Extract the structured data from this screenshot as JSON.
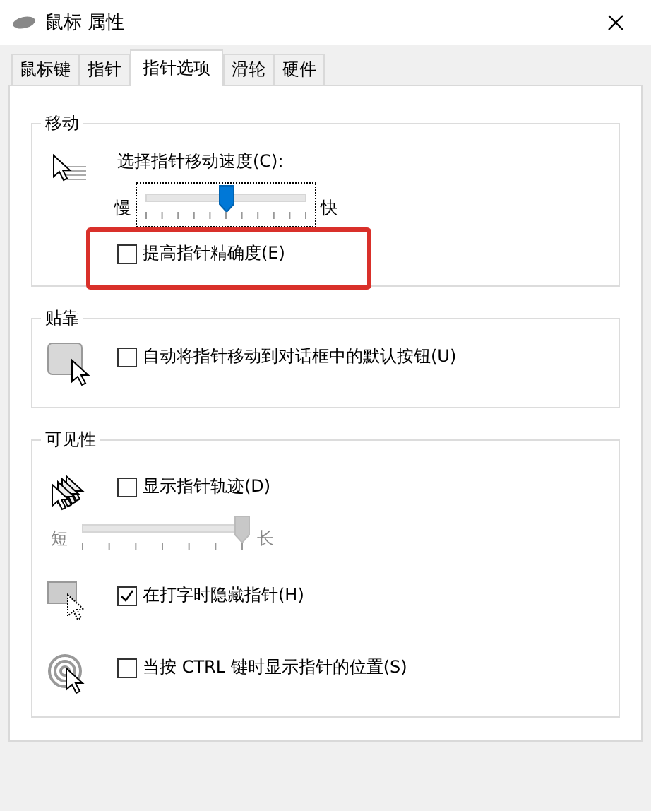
{
  "window": {
    "title": "鼠标 属性"
  },
  "tabs": [
    {
      "label": "鼠标键",
      "selected": false
    },
    {
      "label": "指针",
      "selected": false
    },
    {
      "label": "指针选项",
      "selected": true
    },
    {
      "label": "滑轮",
      "selected": false
    },
    {
      "label": "硬件",
      "selected": false
    }
  ],
  "groups": [
    {
      "title": "移动",
      "rows": [
        {
          "items": [
            {
              "kind": "label",
              "label": "选择指针移动速度(C):"
            },
            {
              "kind": "slider",
              "min_label": "慢",
              "max_label": "快",
              "level": 0.5,
              "disabled": false,
              "focused": true
            },
            {
              "kind": "checkbox",
              "label": "提高指针精确度(E)",
              "checked": false,
              "highlighted": true
            }
          ]
        }
      ]
    },
    {
      "title": "贴靠",
      "rows": [
        {
          "items": [
            {
              "kind": "checkbox",
              "label": "自动将指针移动到对话框中的默认按钮(U)",
              "checked": false,
              "highlighted": false
            }
          ]
        }
      ]
    },
    {
      "title": "可见性",
      "rows": [
        {
          "items": [
            {
              "kind": "checkbox",
              "label": "显示指针轨迹(D)",
              "checked": false,
              "highlighted": false
            },
            {
              "kind": "slider",
              "min_label": "短",
              "max_label": "长",
              "level": 1,
              "disabled": true,
              "focused": false
            }
          ]
        },
        {
          "items": [
            {
              "kind": "checkbox",
              "label": "在打字时隐藏指针(H)",
              "checked": true,
              "highlighted": false
            }
          ]
        },
        {
          "items": [
            {
              "kind": "checkbox",
              "label": "当按 CTRL 键时显示指针的位置(S)",
              "checked": false,
              "highlighted": false
            }
          ]
        }
      ]
    }
  ]
}
